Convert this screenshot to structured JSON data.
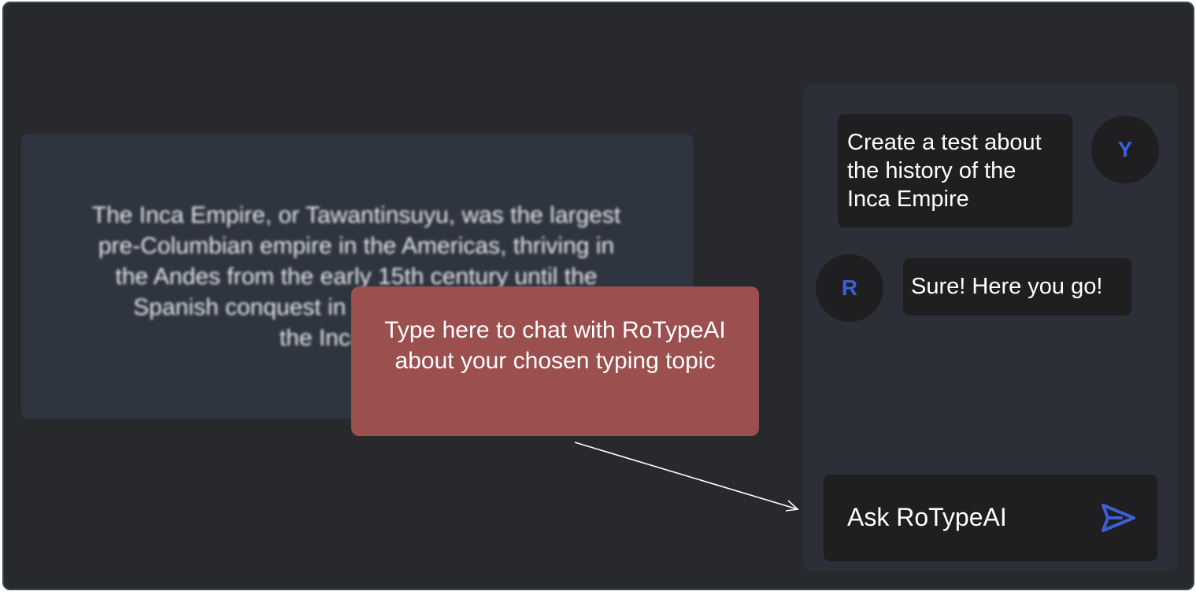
{
  "passage": {
    "text": "The Inca Empire, or Tawantinsuyu, was the largest\npre-Columbian empire in the Americas, thriving in\nthe Andes from the  early 15th century until the\nSpanish conquest in 1533. The Incas were\nthe Incas were"
  },
  "tooltip": {
    "text": "Type here to chat with RoTypeAI about your chosen typing topic"
  },
  "chat": {
    "messages": [
      {
        "sender": "user",
        "avatar_letter": "Y",
        "text": "Create a test about the history of the Inca Empire"
      },
      {
        "sender": "ai",
        "avatar_letter": "R",
        "text": "Sure! Here you go!"
      }
    ],
    "input_placeholder": "Ask RoTypeAI",
    "send_icon": "send-icon",
    "accent_color": "#3d5fd6"
  },
  "colors": {
    "background": "#28292d",
    "panel": "#2d2f38",
    "bubble": "#1f1f21",
    "tooltip": "#9b4f4f"
  }
}
